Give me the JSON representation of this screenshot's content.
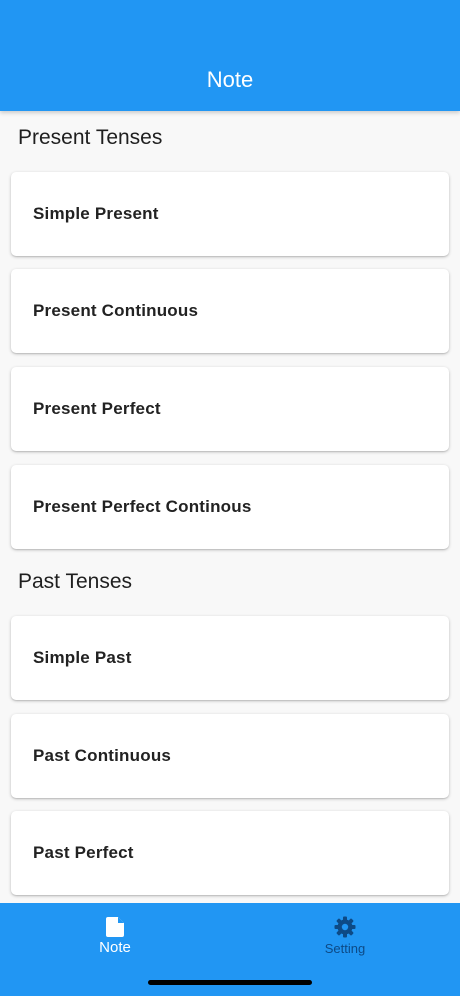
{
  "appbar": {
    "title": "Note"
  },
  "sections": [
    {
      "title": "Present Tenses",
      "items": [
        "Simple Present",
        "Present Continuous",
        "Present Perfect",
        "Present Perfect Continous"
      ]
    },
    {
      "title": "Past Tenses",
      "items": [
        "Simple Past",
        "Past Continuous",
        "Past Perfect"
      ]
    }
  ],
  "bottom_nav": {
    "items": [
      {
        "label": "Note",
        "icon": "note-icon",
        "active": true
      },
      {
        "label": "Setting",
        "icon": "gear-icon",
        "active": false
      }
    ]
  },
  "colors": {
    "primary": "#2196f3",
    "background": "#f8f8f8",
    "inactive_nav": "#0d4a86"
  }
}
